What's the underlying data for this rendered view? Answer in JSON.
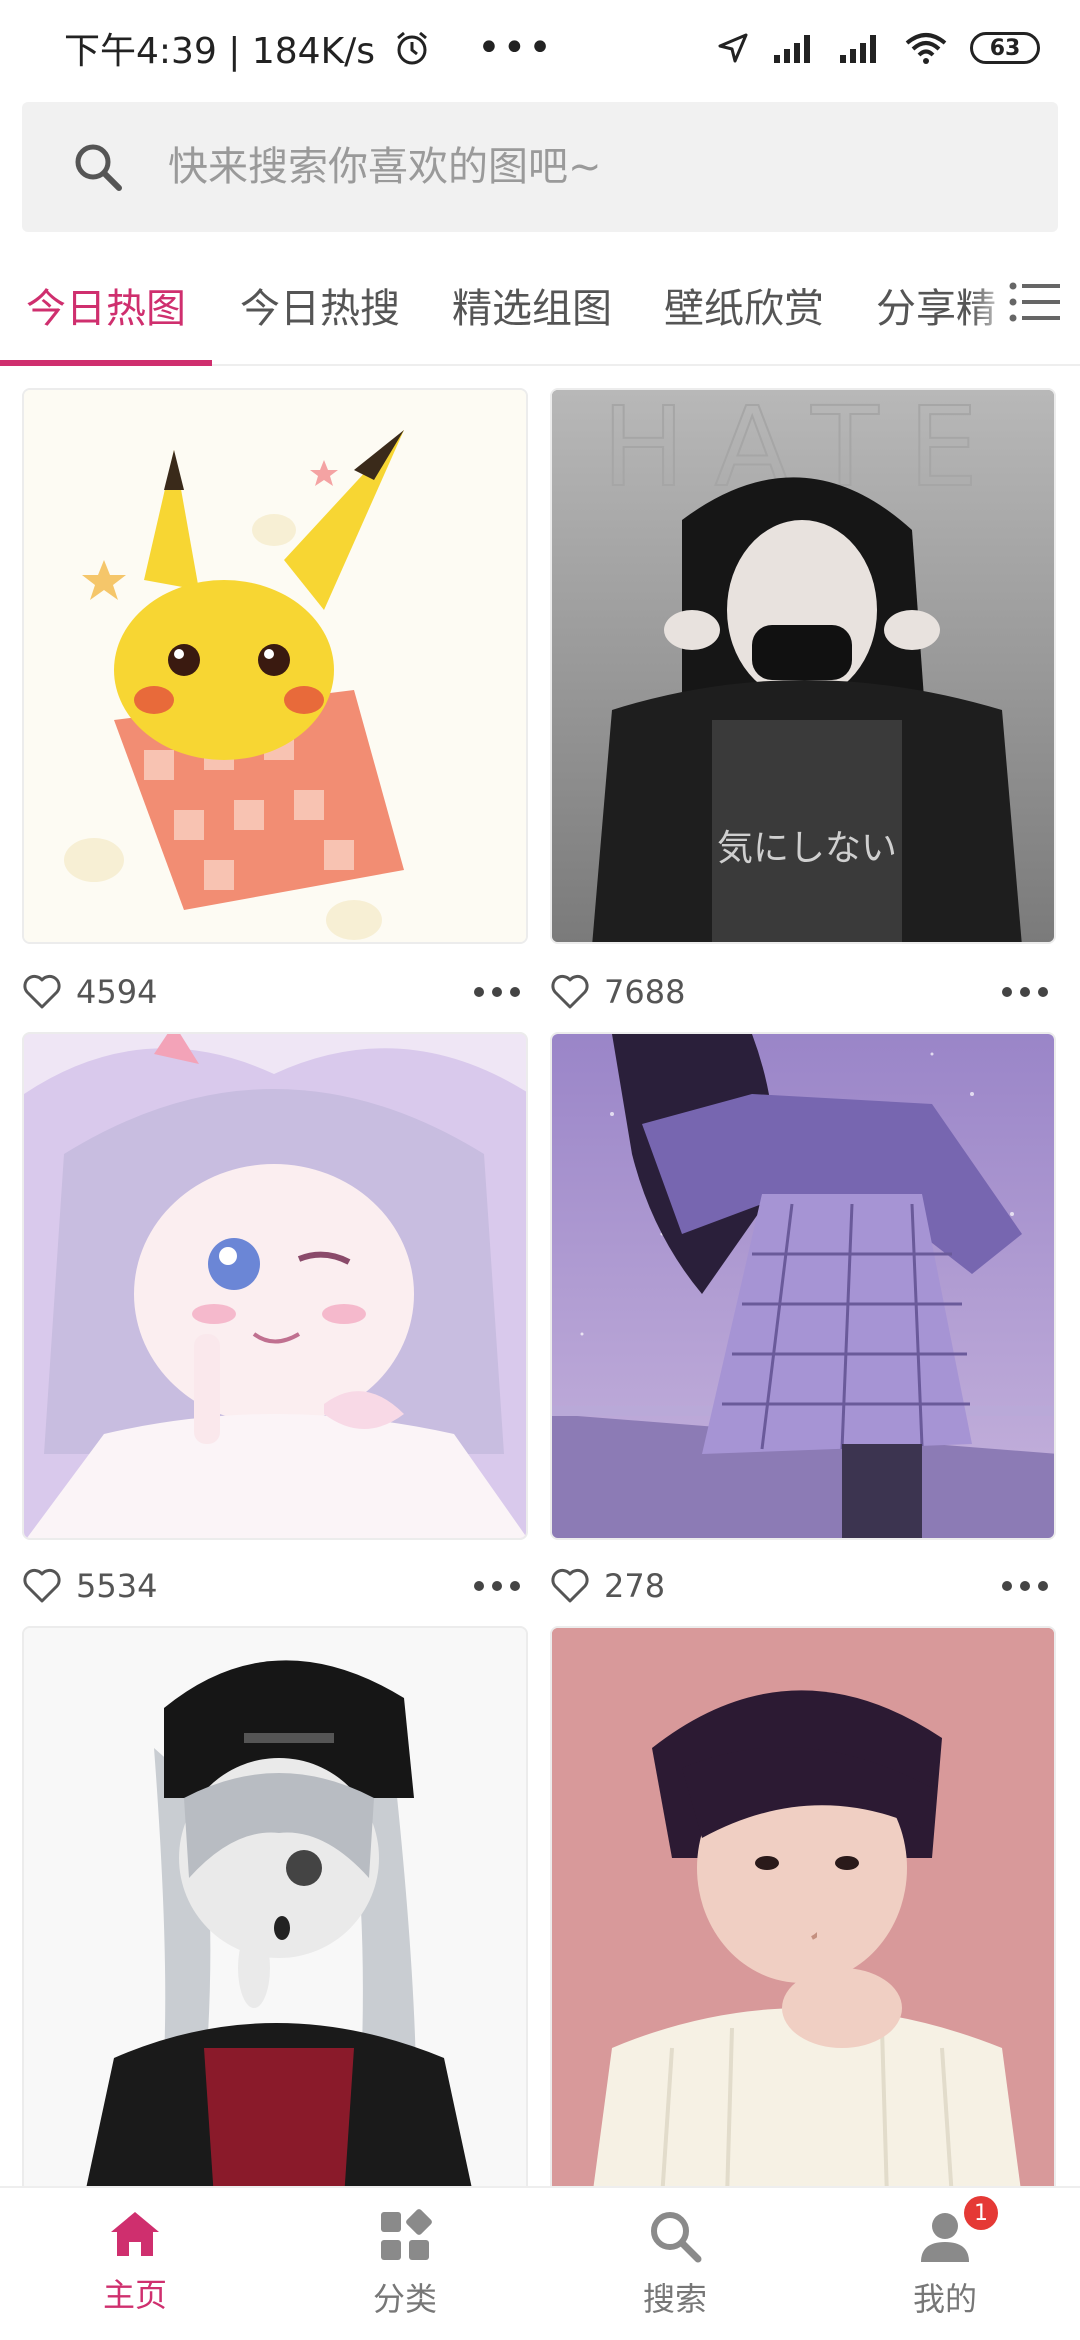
{
  "status_bar": {
    "time_speed": "下午4:39 | 184K/s",
    "more": "•••",
    "battery": "63"
  },
  "search": {
    "placeholder": "快来搜索你喜欢的图吧~"
  },
  "tabs": [
    {
      "label": "今日热图",
      "active": true
    },
    {
      "label": "今日热搜"
    },
    {
      "label": "精选组图"
    },
    {
      "label": "壁纸欣赏"
    },
    {
      "label": "分享精"
    }
  ],
  "cards": [
    {
      "likes": "4594"
    },
    {
      "likes": "7688",
      "overlay_text": "HATE",
      "shirt_text": "気にしない"
    },
    {
      "likes": "5534"
    },
    {
      "likes": "278"
    },
    {},
    {}
  ],
  "bottom_nav": {
    "home": "主页",
    "category": "分类",
    "search": "搜索",
    "mine": "我的",
    "badge": "1"
  },
  "colors": {
    "accent": "#cf2f6e",
    "badge": "#e53935"
  }
}
